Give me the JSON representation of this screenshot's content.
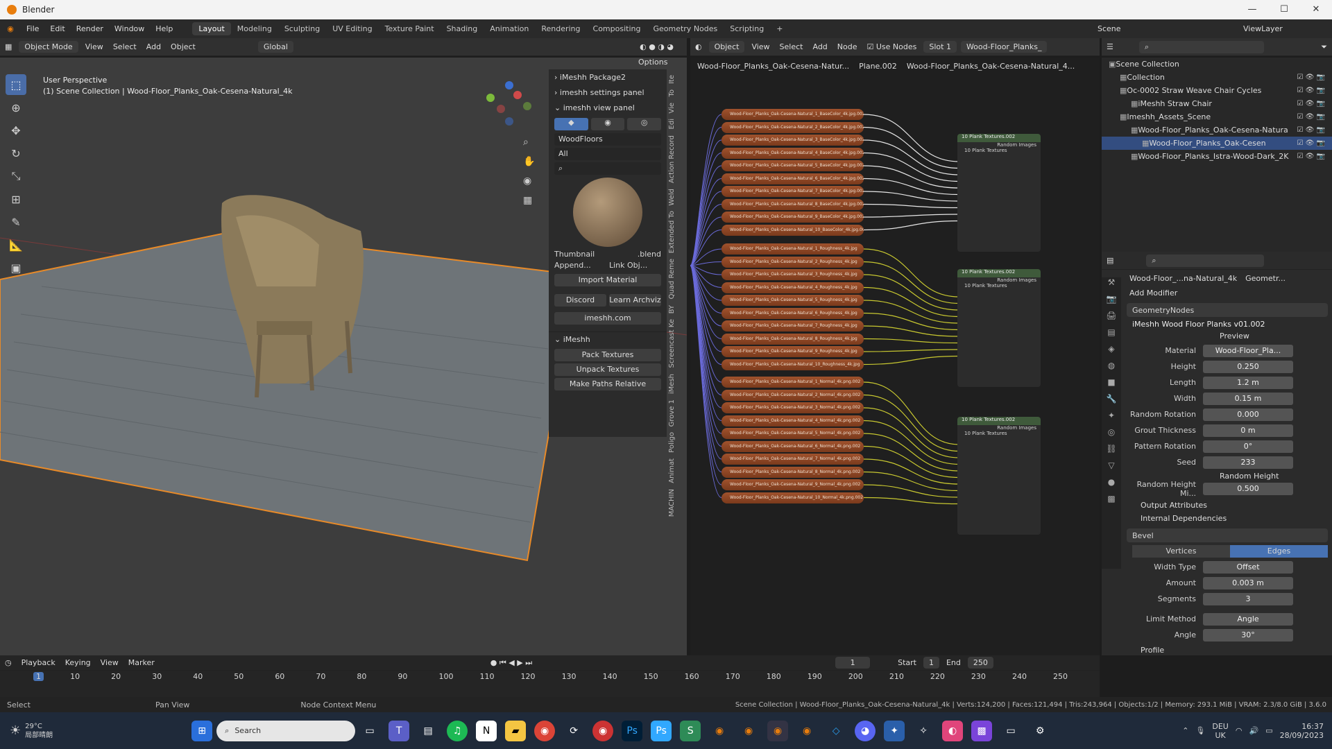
{
  "window": {
    "title": "Blender",
    "min": "—",
    "max": "☐",
    "close": "✕"
  },
  "menu": [
    "File",
    "Edit",
    "Render",
    "Window",
    "Help"
  ],
  "workspaces": [
    "Layout",
    "Modeling",
    "Sculpting",
    "UV Editing",
    "Texture Paint",
    "Shading",
    "Animation",
    "Rendering",
    "Compositing",
    "Geometry Nodes",
    "Scripting"
  ],
  "scene": {
    "label": "Scene",
    "viewlayer": "ViewLayer"
  },
  "viewport": {
    "mode": "Object Mode",
    "menus": [
      "View",
      "Select",
      "Add",
      "Object"
    ],
    "orientation": "Global",
    "options": "Options",
    "perspective": "User Perspective",
    "collection_info": "(1) Scene Collection | Wood-Floor_Planks_Oak-Cesena-Natural_4k"
  },
  "npanel": {
    "p1": "iMeshh Package2",
    "p2": "imeshh settings panel",
    "p3": "imeshh view panel",
    "category": "WoodFloors",
    "filter": "All",
    "thumbnail": "Thumbnail",
    "blend": ".blend",
    "append": "Append...",
    "link": "Link Obj...",
    "import": "Import Material",
    "discord": "Discord",
    "archviz": "Learn Archviz",
    "site": "imeshh.com",
    "imeshh": "iMeshh",
    "pack": "Pack Textures",
    "unpack": "Unpack Textures",
    "relative": "Make Paths Relative"
  },
  "sidetabs": [
    "Ite",
    "To",
    "Vie",
    "Edi",
    "Action Record",
    "Weld",
    "Extended To",
    "Quad Reme",
    "BY",
    "Screencast Ke",
    "iMesh",
    "Grove 1",
    "Poligo",
    "Animat",
    "MACHIN"
  ],
  "nodeeditor": {
    "type": "Object",
    "menus": [
      "View",
      "Select",
      "Add",
      "Node"
    ],
    "use_nodes": "Use Nodes",
    "slot": "Slot 1",
    "material": "Wood-Floor_Planks_",
    "breadcrumb": [
      "Wood-Floor_Planks_Oak-Cesena-Natur...",
      "Plane.002",
      "Wood-Floor_Planks_Oak-Cesena-Natural_4..."
    ],
    "group_title": "10 Plank Textures.002",
    "group_inner": "10 Plank Textures",
    "group_out": "Random Images",
    "nodes_basecolor": [
      "Wood-Floor_Planks_Oak-Cesena-Natural_1_BaseColor_4k.jpg.002",
      "Wood-Floor_Planks_Oak-Cesena-Natural_2_BaseColor_4k.jpg.002",
      "Wood-Floor_Planks_Oak-Cesena-Natural_3_BaseColor_4k.jpg.002",
      "Wood-Floor_Planks_Oak-Cesena-Natural_4_BaseColor_4k.jpg.002",
      "Wood-Floor_Planks_Oak-Cesena-Natural_5_BaseColor_4k.jpg.002",
      "Wood-Floor_Planks_Oak-Cesena-Natural_6_BaseColor_4k.jpg.002",
      "Wood-Floor_Planks_Oak-Cesena-Natural_7_BaseColor_4k.jpg.002",
      "Wood-Floor_Planks_Oak-Cesena-Natural_8_BaseColor_4k.jpg.002",
      "Wood-Floor_Planks_Oak-Cesena-Natural_9_BaseColor_4k.jpg.002",
      "Wood-Floor_Planks_Oak-Cesena-Natural_10_BaseColor_4k.jpg.002"
    ],
    "nodes_roughness": [
      "Wood-Floor_Planks_Oak-Cesena-Natural_1_Roughness_4k.jpg",
      "Wood-Floor_Planks_Oak-Cesena-Natural_2_Roughness_4k.jpg",
      "Wood-Floor_Planks_Oak-Cesena-Natural_3_Roughness_4k.jpg",
      "Wood-Floor_Planks_Oak-Cesena-Natural_4_Roughness_4k.jpg",
      "Wood-Floor_Planks_Oak-Cesena-Natural_5_Roughness_4k.jpg",
      "Wood-Floor_Planks_Oak-Cesena-Natural_6_Roughness_4k.jpg",
      "Wood-Floor_Planks_Oak-Cesena-Natural_7_Roughness_4k.jpg",
      "Wood-Floor_Planks_Oak-Cesena-Natural_8_Roughness_4k.jpg",
      "Wood-Floor_Planks_Oak-Cesena-Natural_9_Roughness_4k.jpg",
      "Wood-Floor_Planks_Oak-Cesena-Natural_10_Roughness_4k.jpg"
    ],
    "nodes_normal": [
      "Wood-Floor_Planks_Oak-Cesena-Natural_1_Normal_4k.png.002",
      "Wood-Floor_Planks_Oak-Cesena-Natural_2_Normal_4k.png.002",
      "Wood-Floor_Planks_Oak-Cesena-Natural_3_Normal_4k.png.002",
      "Wood-Floor_Planks_Oak-Cesena-Natural_4_Normal_4k.png.002",
      "Wood-Floor_Planks_Oak-Cesena-Natural_5_Normal_4k.png.002",
      "Wood-Floor_Planks_Oak-Cesena-Natural_6_Normal_4k.png.002",
      "Wood-Floor_Planks_Oak-Cesena-Natural_7_Normal_4k.png.002",
      "Wood-Floor_Planks_Oak-Cesena-Natural_8_Normal_4k.png.002",
      "Wood-Floor_Planks_Oak-Cesena-Natural_9_Normal_4k.png.002",
      "Wood-Floor_Planks_Oak-Cesena-Natural_10_Normal_4k.png.002"
    ]
  },
  "outliner": {
    "rows": [
      {
        "label": "Scene Collection",
        "depth": 0,
        "sel": false
      },
      {
        "label": "Collection",
        "depth": 1,
        "sel": false
      },
      {
        "label": "Oc-0002 Straw Weave Chair Cycles",
        "depth": 1,
        "sel": false
      },
      {
        "label": "iMeshh Straw Chair",
        "depth": 2,
        "sel": false
      },
      {
        "label": "Imeshh_Assets_Scene",
        "depth": 1,
        "sel": false
      },
      {
        "label": "Wood-Floor_Planks_Oak-Cesena-Natura",
        "depth": 2,
        "sel": false
      },
      {
        "label": "Wood-Floor_Planks_Oak-Cesen",
        "depth": 3,
        "sel": true
      },
      {
        "label": "Wood-Floor_Planks_Istra-Wood-Dark_2K",
        "depth": 2,
        "sel": false
      }
    ]
  },
  "props": {
    "breadcrumb_obj": "Wood-Floor_...na-Natural_4k",
    "breadcrumb_mod": "Geometr...",
    "add_modifier": "Add Modifier",
    "gn_name": "GeometryNodes",
    "nodegroup": "iMeshh Wood Floor Planks v01.002",
    "preview": "Preview",
    "fields": [
      {
        "label": "Material",
        "value": "Wood-Floor_Pla..."
      },
      {
        "label": "Height",
        "value": "0.250"
      },
      {
        "label": "Length",
        "value": "1.2 m"
      },
      {
        "label": "Width",
        "value": "0.15 m"
      },
      {
        "label": "Random Rotation",
        "value": "0.000"
      },
      {
        "label": "Grout Thickness",
        "value": "0 m"
      },
      {
        "label": "Pattern Rotation",
        "value": "0°"
      },
      {
        "label": "Seed",
        "value": "233"
      }
    ],
    "random_height": "Random Height",
    "random_height_mi_label": "Random Height Mi...",
    "random_height_mi": "0.500",
    "output_attrs": "Output Attributes",
    "internal_deps": "Internal Dependencies",
    "bevel": "Bevel",
    "vertices": "Vertices",
    "edges": "Edges",
    "bevel_fields": [
      {
        "label": "Width Type",
        "value": "Offset"
      },
      {
        "label": "Amount",
        "value": "0.003 m"
      },
      {
        "label": "Segments",
        "value": "3"
      }
    ],
    "limit_method_label": "Limit Method",
    "limit_method": "Angle",
    "angle_label": "Angle",
    "angle": "30°",
    "profile": "Profile"
  },
  "timeline": {
    "menus": [
      "Playback",
      "Keying",
      "View",
      "Marker"
    ],
    "frame": "1",
    "start_label": "Start",
    "start": "1",
    "end_label": "End",
    "end": "250",
    "ticks": [
      "1",
      "10",
      "20",
      "30",
      "40",
      "50",
      "60",
      "70",
      "80",
      "90",
      "100",
      "110",
      "120",
      "130",
      "140",
      "150",
      "160",
      "170",
      "180",
      "190",
      "200",
      "210",
      "220",
      "230",
      "240",
      "250"
    ]
  },
  "status": {
    "select": "Select",
    "pan": "Pan View",
    "ctx": "Node Context Menu",
    "info": "Scene Collection | Wood-Floor_Planks_Oak-Cesena-Natural_4k | Verts:124,200 | Faces:121,494 | Tris:243,964 | Objects:1/2 | Memory: 293.1 MiB | VRAM: 2.3/8.0 GiB | 3.6.0"
  },
  "taskbar": {
    "temp": "29°C",
    "weather": "局部晴朗",
    "search": "Search",
    "lang": "DEU",
    "region": "UK",
    "time": "16:37",
    "date": "28/09/2023"
  }
}
